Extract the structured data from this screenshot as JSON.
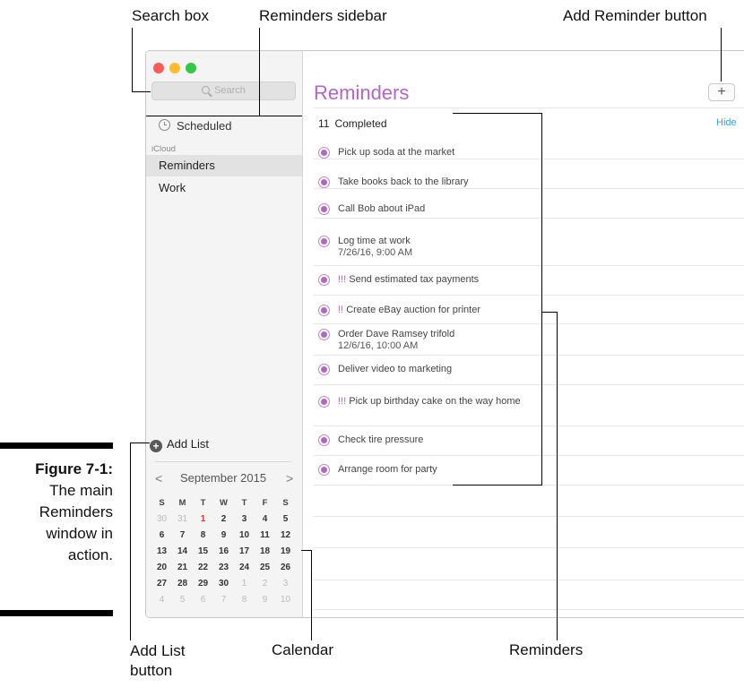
{
  "callouts": {
    "search_box": "Search box",
    "reminders_sidebar": "Reminders sidebar",
    "add_reminder_button": "Add Reminder button",
    "add_list_line1": "Add List",
    "add_list_line2": "button",
    "calendar": "Calendar",
    "reminders": "Reminders"
  },
  "caption": {
    "label": "Figure 7-1:",
    "line1": "The main",
    "line2": "Reminders",
    "line3": "window in",
    "line4": "action."
  },
  "colors": {
    "accent": "#b267c2",
    "link": "#3a9fdc",
    "today": "#e03a2a"
  },
  "sidebar": {
    "search_placeholder": "Search",
    "scheduled": "Scheduled",
    "group": "iCloud",
    "lists": [
      "Reminders",
      "Work"
    ],
    "selected_list": "Reminders",
    "add_list": "Add List"
  },
  "calendar": {
    "prev": "<",
    "next": ">",
    "month": "September 2015",
    "weekdays": [
      "S",
      "M",
      "T",
      "W",
      "T",
      "F",
      "S"
    ],
    "weeks": [
      [
        "30",
        "31",
        "1",
        "2",
        "3",
        "4",
        "5"
      ],
      [
        "6",
        "7",
        "8",
        "9",
        "10",
        "11",
        "12"
      ],
      [
        "13",
        "14",
        "15",
        "16",
        "17",
        "18",
        "19"
      ],
      [
        "20",
        "21",
        "22",
        "23",
        "24",
        "25",
        "26"
      ],
      [
        "27",
        "28",
        "29",
        "30",
        "1",
        "2",
        "3"
      ],
      [
        "4",
        "5",
        "6",
        "7",
        "8",
        "9",
        "10"
      ]
    ],
    "today": "1"
  },
  "main": {
    "title": "Reminders",
    "add_button": "+",
    "completed_count": "11",
    "completed_label": "Completed",
    "hide": "Hide",
    "reminders": [
      {
        "priority": "",
        "text": "Pick up soda at the market",
        "sub": ""
      },
      {
        "priority": "",
        "text": "Take books back to the library",
        "sub": ""
      },
      {
        "priority": "",
        "text": "Call Bob about iPad",
        "sub": ""
      },
      {
        "priority": "",
        "text": "Log time at work",
        "sub": "7/26/16, 9:00 AM"
      },
      {
        "priority": "!!!",
        "text": "Send estimated tax payments",
        "sub": ""
      },
      {
        "priority": "!!",
        "text": "Create eBay auction for printer",
        "sub": ""
      },
      {
        "priority": "",
        "text": "Order Dave Ramsey trifold",
        "sub": "12/6/16, 10:00 AM"
      },
      {
        "priority": "",
        "text": "Deliver video to marketing",
        "sub": ""
      },
      {
        "priority": "!!!",
        "text": "Pick up birthday cake on the way home",
        "sub": ""
      },
      {
        "priority": "",
        "text": "Check tire pressure",
        "sub": ""
      },
      {
        "priority": "",
        "text": "Arrange room for party",
        "sub": ""
      }
    ]
  }
}
